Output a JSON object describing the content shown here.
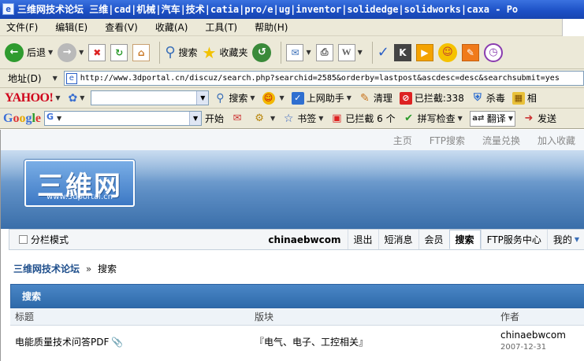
{
  "window": {
    "title": "三维网技术论坛 三维|cad|机械|汽车|技术|catia|pro/e|ug|inventor|solidedge|solidworks|caxa - Po"
  },
  "menu": [
    "文件(F)",
    "编辑(E)",
    "查看(V)",
    "收藏(A)",
    "工具(T)",
    "帮助(H)"
  ],
  "toolbar": {
    "back_label": "后退",
    "search_label": "搜索",
    "favorites_label": "收藏夹"
  },
  "address": {
    "label": "地址(D)",
    "url": "http://www.3dportal.cn/discuz/search.php?searchid=2585&orderby=lastpost&ascdesc=desc&searchsubmit=yes"
  },
  "yahoo_toolbar": {
    "logo": "YAHOO!",
    "search_label": "搜索",
    "assistant_label": "上网助手",
    "clean_label": "清理",
    "blocked_label": "已拦截:338",
    "antivirus_label": "杀毒",
    "more_label": "相"
  },
  "google_toolbar": {
    "logo": "Google",
    "go_label": "开始",
    "bookmarks_label": "书签",
    "blocked_label": "已拦截 6 个",
    "spellcheck_label": "拼写检查",
    "translate_label": "翻译",
    "send_label": "发送"
  },
  "site": {
    "top_links": [
      "主页",
      "FTP搜索",
      "流量兑换",
      "加入收藏"
    ],
    "logo_cn": "三維网",
    "logo_en": "www.3dportal.cn",
    "mode_label": "分栏模式",
    "username": "chinaebwcom",
    "nav": [
      "退出",
      "短消息",
      "会员",
      "搜索",
      "FTP服务中心",
      "我的"
    ],
    "breadcrumb_home": "三维网技术论坛",
    "breadcrumb_arrow": "»",
    "breadcrumb_current": "搜索",
    "panel_title": "搜索",
    "columns": [
      "标题",
      "版块",
      "作者"
    ],
    "rows": [
      {
        "title": "电能质量技术问答PDF",
        "forum": "『电气、电子、工控相关』",
        "author": "chinaebwcom",
        "date": "2007-12-31"
      }
    ]
  }
}
